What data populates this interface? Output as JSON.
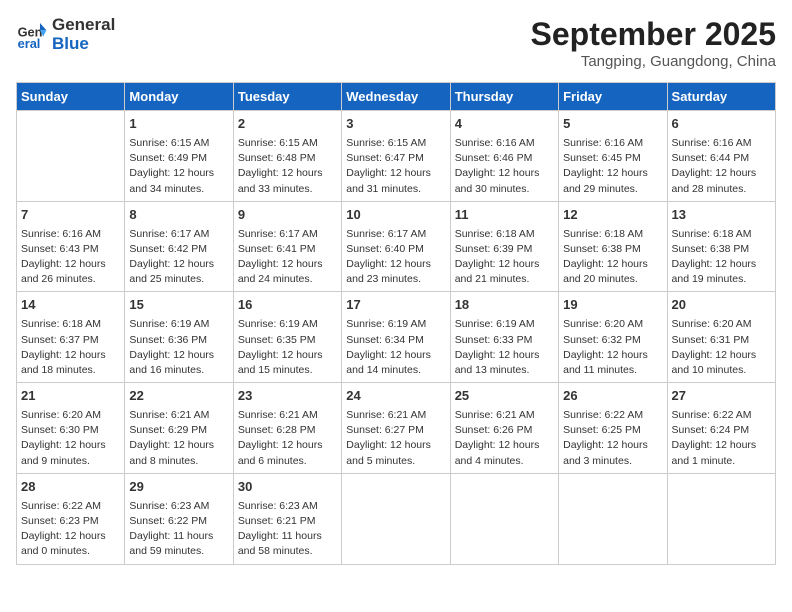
{
  "header": {
    "logo_line1": "General",
    "logo_line2": "Blue",
    "month": "September 2025",
    "location": "Tangping, Guangdong, China"
  },
  "days_of_week": [
    "Sunday",
    "Monday",
    "Tuesday",
    "Wednesday",
    "Thursday",
    "Friday",
    "Saturday"
  ],
  "weeks": [
    [
      {
        "day": "",
        "info": ""
      },
      {
        "day": "1",
        "info": "Sunrise: 6:15 AM\nSunset: 6:49 PM\nDaylight: 12 hours\nand 34 minutes."
      },
      {
        "day": "2",
        "info": "Sunrise: 6:15 AM\nSunset: 6:48 PM\nDaylight: 12 hours\nand 33 minutes."
      },
      {
        "day": "3",
        "info": "Sunrise: 6:15 AM\nSunset: 6:47 PM\nDaylight: 12 hours\nand 31 minutes."
      },
      {
        "day": "4",
        "info": "Sunrise: 6:16 AM\nSunset: 6:46 PM\nDaylight: 12 hours\nand 30 minutes."
      },
      {
        "day": "5",
        "info": "Sunrise: 6:16 AM\nSunset: 6:45 PM\nDaylight: 12 hours\nand 29 minutes."
      },
      {
        "day": "6",
        "info": "Sunrise: 6:16 AM\nSunset: 6:44 PM\nDaylight: 12 hours\nand 28 minutes."
      }
    ],
    [
      {
        "day": "7",
        "info": "Sunrise: 6:16 AM\nSunset: 6:43 PM\nDaylight: 12 hours\nand 26 minutes."
      },
      {
        "day": "8",
        "info": "Sunrise: 6:17 AM\nSunset: 6:42 PM\nDaylight: 12 hours\nand 25 minutes."
      },
      {
        "day": "9",
        "info": "Sunrise: 6:17 AM\nSunset: 6:41 PM\nDaylight: 12 hours\nand 24 minutes."
      },
      {
        "day": "10",
        "info": "Sunrise: 6:17 AM\nSunset: 6:40 PM\nDaylight: 12 hours\nand 23 minutes."
      },
      {
        "day": "11",
        "info": "Sunrise: 6:18 AM\nSunset: 6:39 PM\nDaylight: 12 hours\nand 21 minutes."
      },
      {
        "day": "12",
        "info": "Sunrise: 6:18 AM\nSunset: 6:38 PM\nDaylight: 12 hours\nand 20 minutes."
      },
      {
        "day": "13",
        "info": "Sunrise: 6:18 AM\nSunset: 6:38 PM\nDaylight: 12 hours\nand 19 minutes."
      }
    ],
    [
      {
        "day": "14",
        "info": "Sunrise: 6:18 AM\nSunset: 6:37 PM\nDaylight: 12 hours\nand 18 minutes."
      },
      {
        "day": "15",
        "info": "Sunrise: 6:19 AM\nSunset: 6:36 PM\nDaylight: 12 hours\nand 16 minutes."
      },
      {
        "day": "16",
        "info": "Sunrise: 6:19 AM\nSunset: 6:35 PM\nDaylight: 12 hours\nand 15 minutes."
      },
      {
        "day": "17",
        "info": "Sunrise: 6:19 AM\nSunset: 6:34 PM\nDaylight: 12 hours\nand 14 minutes."
      },
      {
        "day": "18",
        "info": "Sunrise: 6:19 AM\nSunset: 6:33 PM\nDaylight: 12 hours\nand 13 minutes."
      },
      {
        "day": "19",
        "info": "Sunrise: 6:20 AM\nSunset: 6:32 PM\nDaylight: 12 hours\nand 11 minutes."
      },
      {
        "day": "20",
        "info": "Sunrise: 6:20 AM\nSunset: 6:31 PM\nDaylight: 12 hours\nand 10 minutes."
      }
    ],
    [
      {
        "day": "21",
        "info": "Sunrise: 6:20 AM\nSunset: 6:30 PM\nDaylight: 12 hours\nand 9 minutes."
      },
      {
        "day": "22",
        "info": "Sunrise: 6:21 AM\nSunset: 6:29 PM\nDaylight: 12 hours\nand 8 minutes."
      },
      {
        "day": "23",
        "info": "Sunrise: 6:21 AM\nSunset: 6:28 PM\nDaylight: 12 hours\nand 6 minutes."
      },
      {
        "day": "24",
        "info": "Sunrise: 6:21 AM\nSunset: 6:27 PM\nDaylight: 12 hours\nand 5 minutes."
      },
      {
        "day": "25",
        "info": "Sunrise: 6:21 AM\nSunset: 6:26 PM\nDaylight: 12 hours\nand 4 minutes."
      },
      {
        "day": "26",
        "info": "Sunrise: 6:22 AM\nSunset: 6:25 PM\nDaylight: 12 hours\nand 3 minutes."
      },
      {
        "day": "27",
        "info": "Sunrise: 6:22 AM\nSunset: 6:24 PM\nDaylight: 12 hours\nand 1 minute."
      }
    ],
    [
      {
        "day": "28",
        "info": "Sunrise: 6:22 AM\nSunset: 6:23 PM\nDaylight: 12 hours\nand 0 minutes."
      },
      {
        "day": "29",
        "info": "Sunrise: 6:23 AM\nSunset: 6:22 PM\nDaylight: 11 hours\nand 59 minutes."
      },
      {
        "day": "30",
        "info": "Sunrise: 6:23 AM\nSunset: 6:21 PM\nDaylight: 11 hours\nand 58 minutes."
      },
      {
        "day": "",
        "info": ""
      },
      {
        "day": "",
        "info": ""
      },
      {
        "day": "",
        "info": ""
      },
      {
        "day": "",
        "info": ""
      }
    ]
  ]
}
